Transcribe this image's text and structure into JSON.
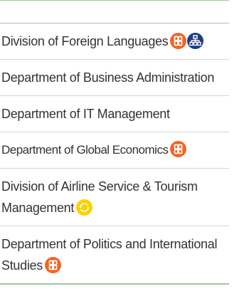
{
  "menu": {
    "items": [
      {
        "label": "Division of Foreign Languages",
        "badges": [
          "globe-orange",
          "org-blue"
        ]
      },
      {
        "label": "Department of Business Administration"
      },
      {
        "label": "Department of IT Management"
      },
      {
        "label": "Department of Global Economics",
        "badges": [
          "globe-orange"
        ]
      },
      {
        "label": "Division of Airline Service & Tourism Management",
        "badges": [
          "cycle-yellow"
        ]
      },
      {
        "label": "Department of Politics and International Studies",
        "badges": [
          "globe-orange"
        ]
      }
    ]
  },
  "colors": {
    "orange_badge": "#f26522",
    "blue_badge": "#1d3f86",
    "yellow_badge": "#ffd000",
    "divider": "#9ec7a0"
  },
  "icons": [
    "global-program-icon",
    "organization-icon",
    "cycle-icon"
  ]
}
